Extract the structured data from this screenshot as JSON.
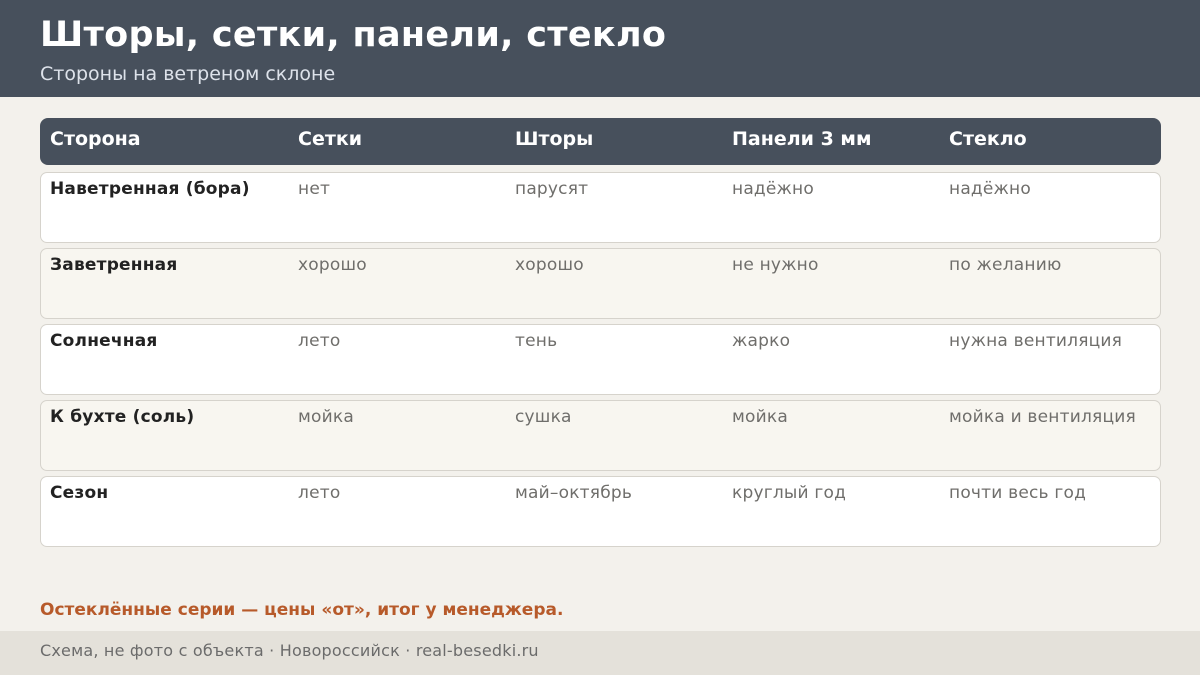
{
  "header": {
    "title": "Шторы, сетки, панели, стекло",
    "subtitle": "Стороны на ветреном склоне"
  },
  "table": {
    "columns": [
      "Сторона",
      "Сетки",
      "Шторы",
      "Панели 3 мм",
      "Стекло"
    ],
    "rows": [
      [
        "Наветренная (бора)",
        "нет",
        "парусят",
        "надёжно",
        "надёжно"
      ],
      [
        "Заветренная",
        "хорошо",
        "хорошо",
        "не нужно",
        "по желанию"
      ],
      [
        "Солнечная",
        "лето",
        "тень",
        "жарко",
        "нужна вентиляция"
      ],
      [
        "К бухте (соль)",
        "мойка",
        "сушка",
        "мойка",
        "мойка и вентиляция"
      ],
      [
        "Сезон",
        "лето",
        "май–октябрь",
        "круглый год",
        "почти весь год"
      ]
    ]
  },
  "note": "Остеклённые серии — цены «от», итог у менеджера.",
  "footer": {
    "text": "Схема, не фото с объекта  ·  Новороссийск  ·  real-besedki.ru"
  },
  "colors": {
    "header_bg": "#47505c",
    "accent": "#b75a2a",
    "page_bg": "#f3f1ec"
  }
}
